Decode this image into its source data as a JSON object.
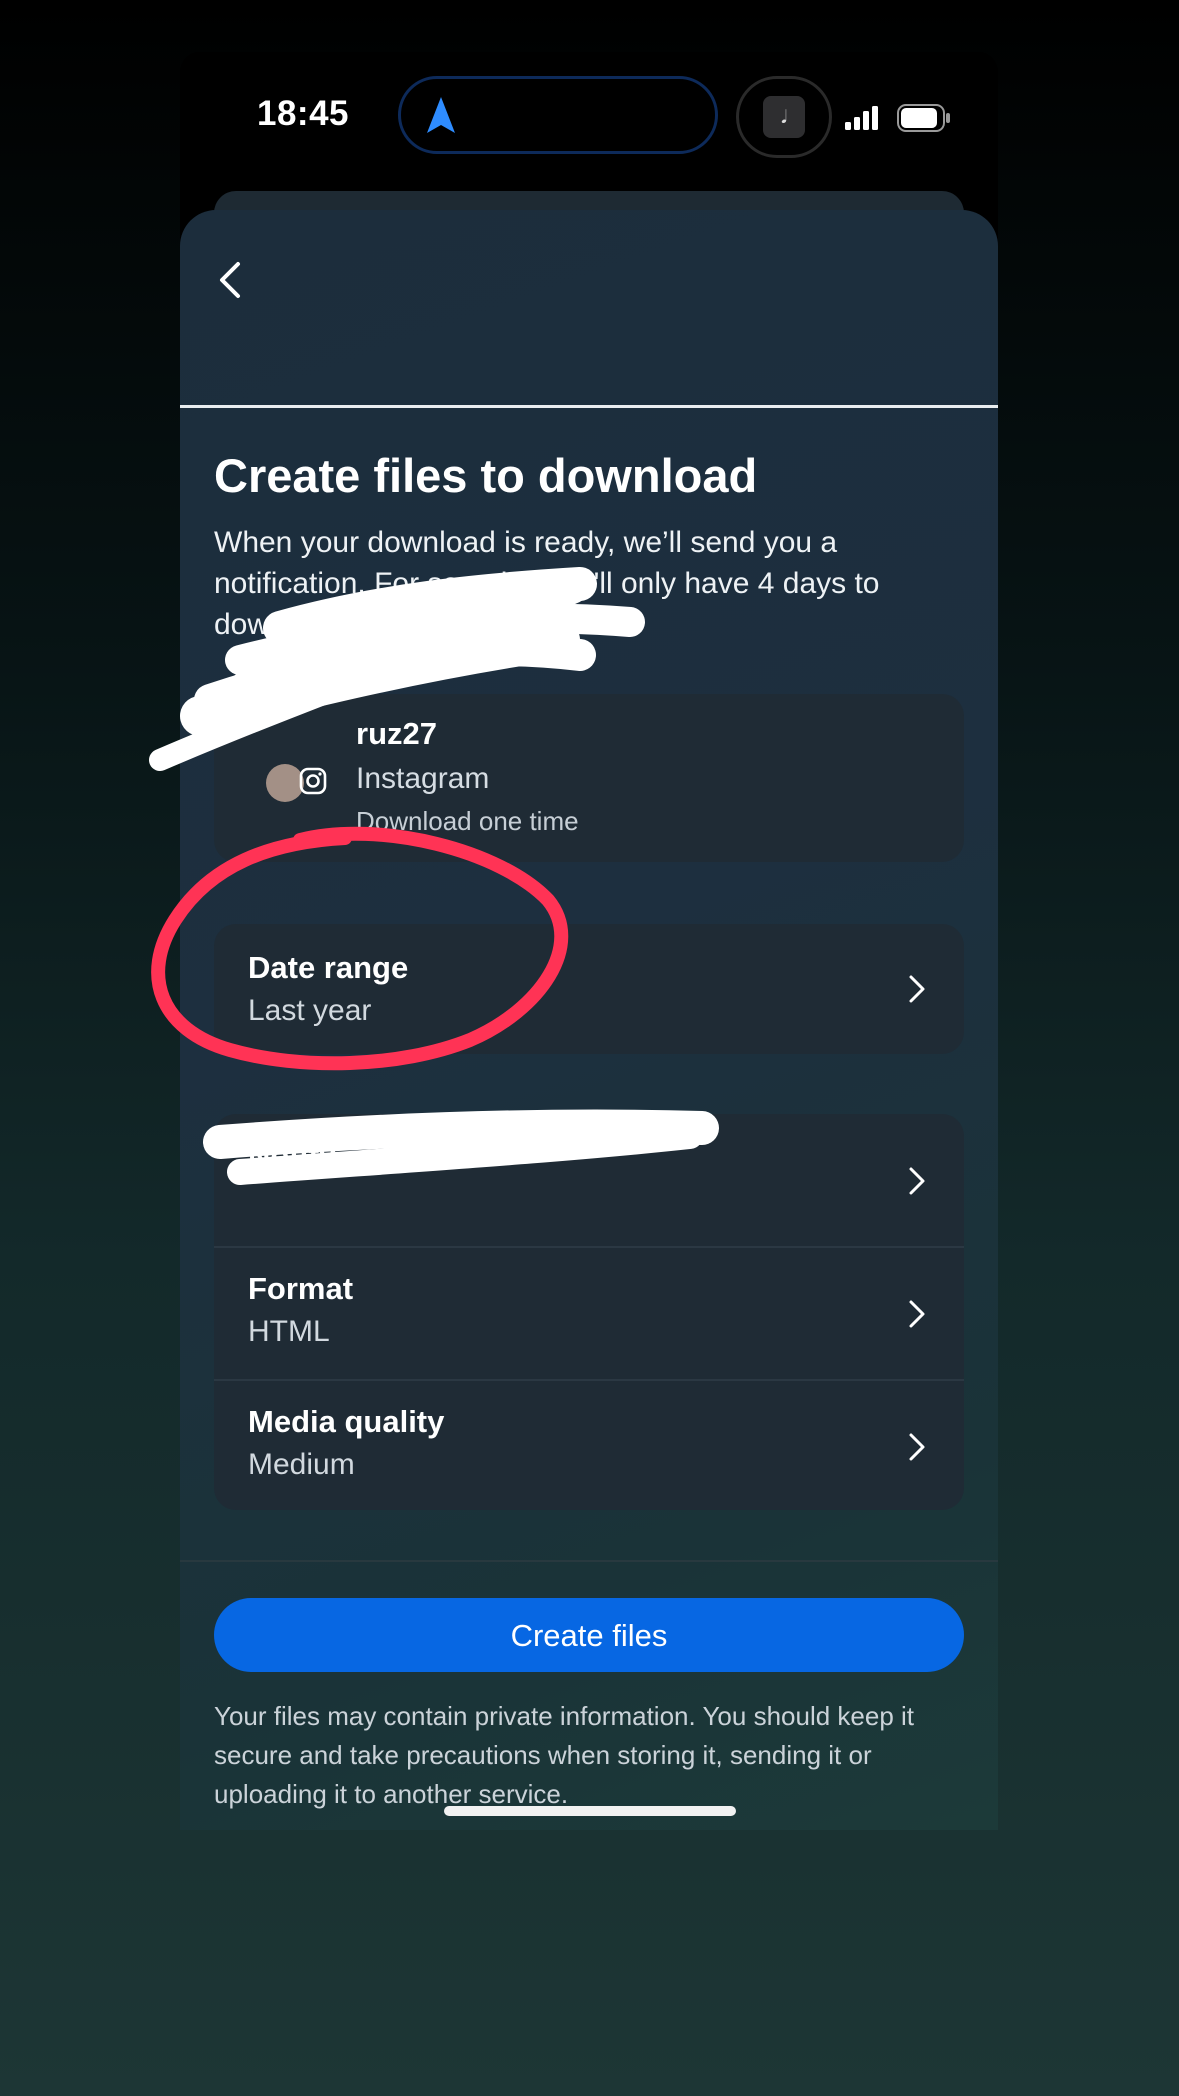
{
  "status_bar": {
    "time": "18:45",
    "nav_icon": "location-arrow-icon",
    "music_icon": "music-note-icon",
    "music_glyph": "𝅘𝅥",
    "signal_icon": "cellular-signal-icon",
    "battery_icon": "battery-icon"
  },
  "header": {
    "back_icon": "chevron-left-icon"
  },
  "page": {
    "title": "Create files to download",
    "description": "When your download is ready, we’ll send you a notification. For security, you'll only have 4 days to download your files."
  },
  "account": {
    "username_visible": "ruz27",
    "app": "Instagram",
    "frequency": "Download one time",
    "app_icon": "instagram-icon"
  },
  "date_range": {
    "label": "Date range",
    "value": "Last year"
  },
  "settings": {
    "notify": {
      "label": "Notify",
      "value": ""
    },
    "format": {
      "label": "Format",
      "value": "HTML"
    },
    "media_quality": {
      "label": "Media quality",
      "value": "Medium"
    }
  },
  "actions": {
    "create_label": "Create files"
  },
  "disclaimer": "Your files may contain private information. You should keep it secure and take precautions when storing it, sending it or uploading it to another service.",
  "colors": {
    "accent": "#0767e3",
    "annotation_circle": "#ff3355",
    "redaction": "#ffffff"
  }
}
